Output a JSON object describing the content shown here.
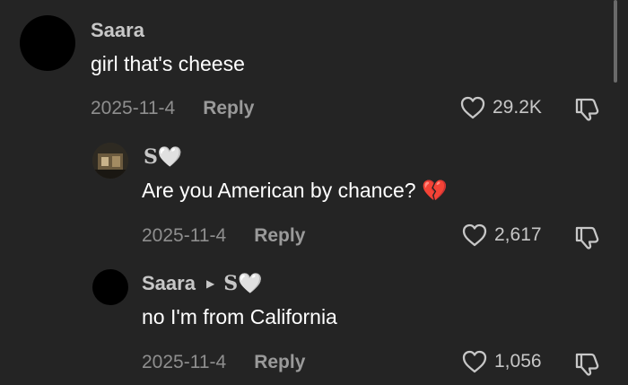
{
  "comments": [
    {
      "username": "Saara",
      "text": "girl that's cheese",
      "date": "2025-11-4",
      "reply_label": "Reply",
      "likes": "29.2K"
    },
    {
      "username": "S🤍",
      "text": "Are you American by chance? 💔",
      "date": "2025-11-4",
      "reply_label": "Reply",
      "likes": "2,617"
    },
    {
      "username": "Saara",
      "reply_to": "S🤍",
      "text": "no I'm from California",
      "date": "2025-11-4",
      "reply_label": "Reply",
      "likes": "1,056"
    }
  ],
  "icons": {
    "like": "heart-outline-icon",
    "dislike": "thumbs-down-icon",
    "reply_arrow": "triangle-right-icon"
  }
}
